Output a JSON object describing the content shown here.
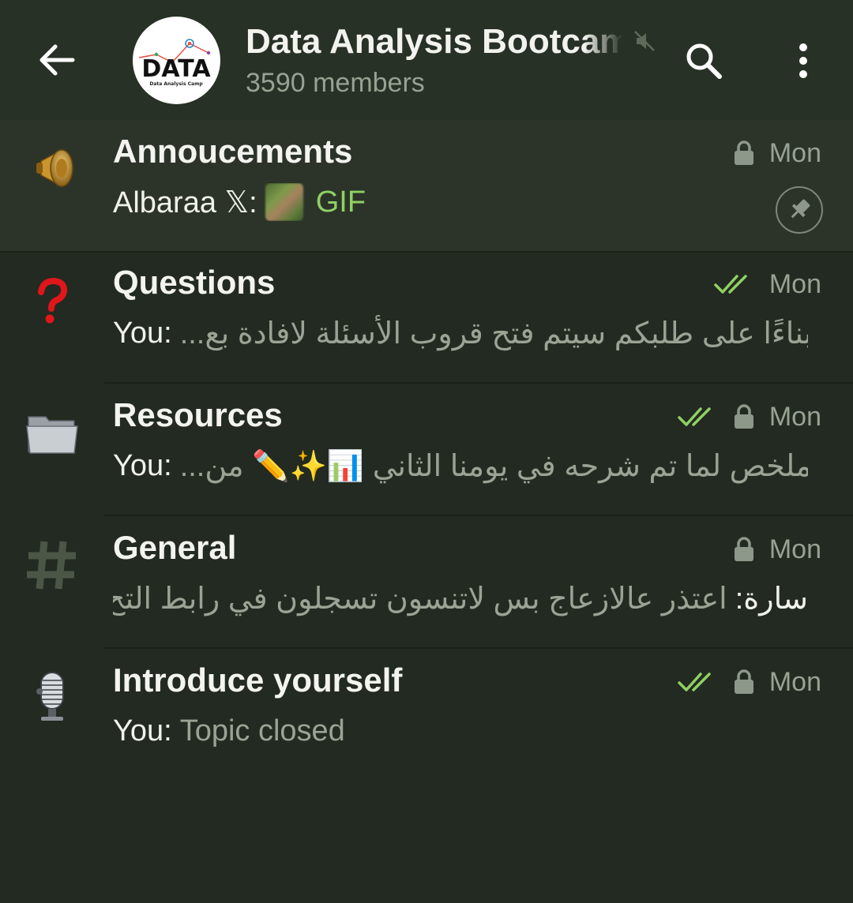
{
  "header": {
    "title": "Data Analysis Bootcamp",
    "subtitle": "3590 members",
    "avatar_text": "DATA",
    "avatar_subtext": "Data Analysis Camp",
    "muted": true
  },
  "colors": {
    "background": "#232a21",
    "header": "#283125",
    "pinned_row": "#2c3429",
    "muted_text": "#98a293",
    "accent_green": "#8fd163"
  },
  "topics": [
    {
      "name": "Annoucements",
      "icon": "megaphone-icon",
      "time": "Mon",
      "locked": true,
      "read_checks": false,
      "pinned": true,
      "sender": "Albaraa 𝕏:",
      "preview": "GIF",
      "preview_type": "gif"
    },
    {
      "name": "Questions",
      "icon": "question-mark-icon",
      "time": "Mon",
      "locked": false,
      "read_checks": true,
      "pinned": false,
      "sender": "You:",
      "preview": "بناءًا على طلبكم سيتم فتح قروب الأسئلة لافادة بع..."
    },
    {
      "name": "Resources",
      "icon": "folder-icon",
      "time": "Mon",
      "locked": true,
      "read_checks": true,
      "pinned": false,
      "sender": "You:",
      "preview": "ملخص لما تم شرحه في يومنا الثاني 📊✨✏️ من..."
    },
    {
      "name": "General",
      "icon": "hashtag-icon",
      "time": "Mon",
      "locked": true,
      "read_checks": false,
      "pinned": false,
      "sender": "سارة:",
      "preview": "اعتذر عالازعاج بس لاتنسون تسجلون في رابط التح..."
    },
    {
      "name": "Introduce yourself",
      "icon": "microphone-icon",
      "time": "Mon",
      "locked": true,
      "read_checks": true,
      "pinned": false,
      "sender": "You:",
      "preview": "Topic closed"
    }
  ]
}
